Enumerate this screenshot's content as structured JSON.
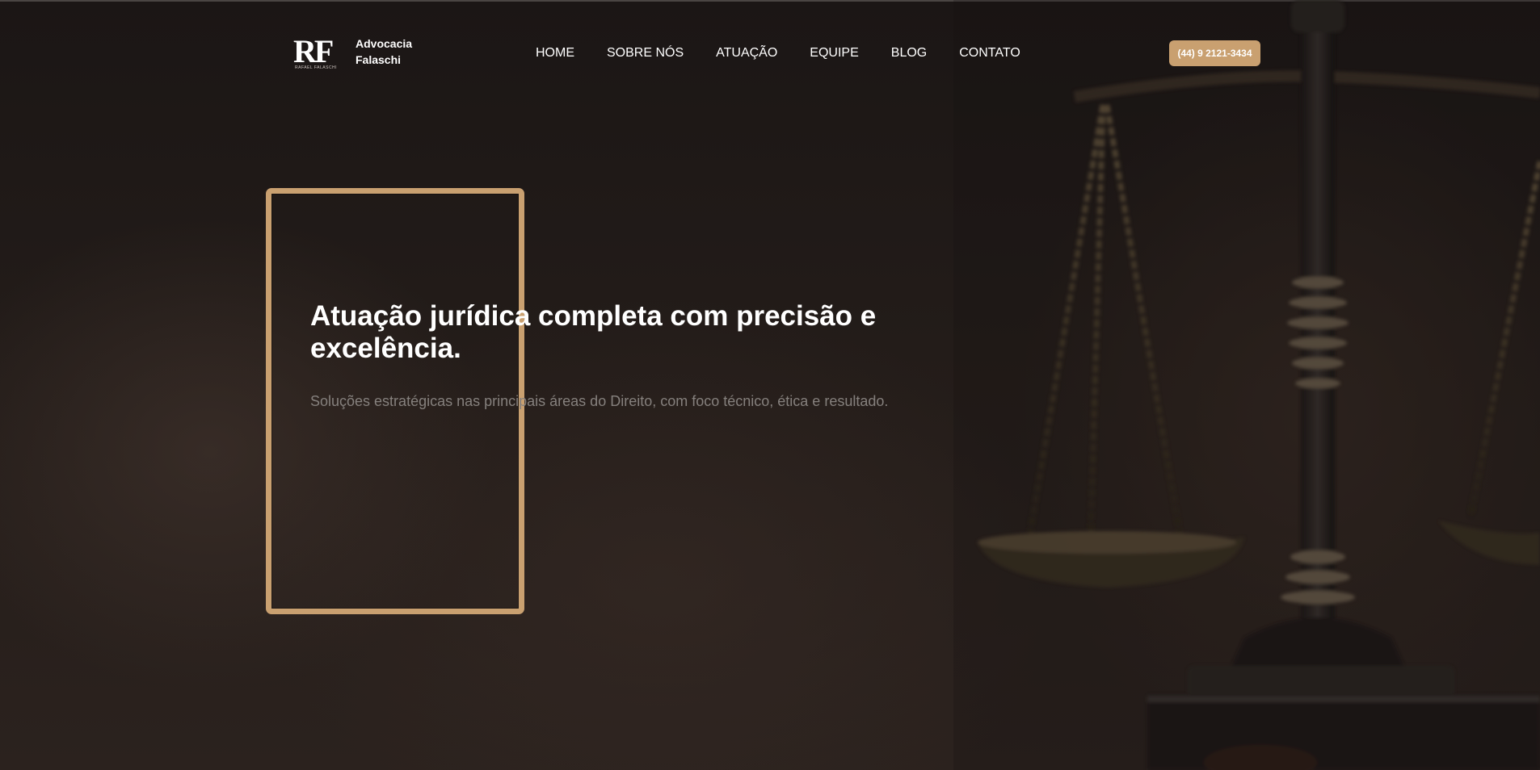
{
  "header": {
    "logo_mark": "RF",
    "logo_mark_sub": "RAFAEL FALASCHI",
    "logo_line1": "Advocacia",
    "logo_line2": "Falaschi",
    "nav": [
      {
        "label": "HOME"
      },
      {
        "label": "SOBRE NÓS"
      },
      {
        "label": "ATUAÇÃO"
      },
      {
        "label": "EQUIPE"
      },
      {
        "label": "BLOG"
      },
      {
        "label": "CONTATO"
      }
    ],
    "phone_label": "(44) 9 2121-3434"
  },
  "hero": {
    "title": "Atuação jurídica completa com precisão e excelência.",
    "subtitle": "Soluções estratégicas nas principais áreas do Direito, com foco técnico, ética e resultado."
  },
  "colors": {
    "accent": "#c9a070",
    "background": "#1b1615",
    "text": "#ffffff",
    "muted_text": "#85807d"
  },
  "icons": {
    "background_image": "scales-of-justice-illustration"
  }
}
